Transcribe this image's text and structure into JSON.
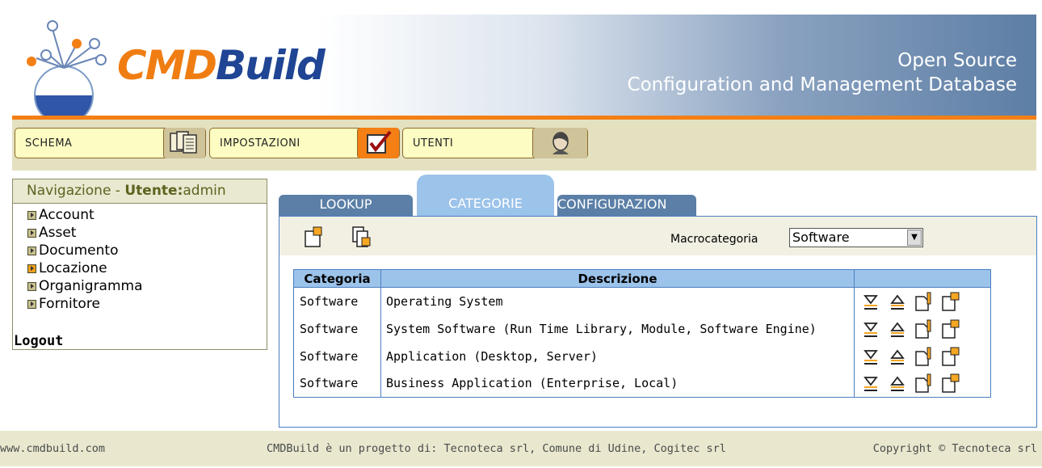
{
  "header": {
    "brand_part1": "CMD",
    "brand_part2": "Build",
    "tagline_line1": "Open Source",
    "tagline_line2": "Configuration and Management Database"
  },
  "menu": {
    "schema_label": "SCHEMA",
    "impostazioni_label": "IMPOSTAZIONI",
    "utenti_label": "UTENTI"
  },
  "nav": {
    "title_prefix": "Navigazione - ",
    "user_label": "Utente:",
    "user_name": "admin",
    "items": [
      {
        "label": "Account",
        "highlight": false
      },
      {
        "label": "Asset",
        "highlight": false
      },
      {
        "label": "Documento",
        "highlight": false
      },
      {
        "label": "Locazione",
        "highlight": true
      },
      {
        "label": "Organigramma",
        "highlight": false
      },
      {
        "label": "Fornitore",
        "highlight": false
      }
    ],
    "logout_label": "Logout"
  },
  "tabs": {
    "lookup": "LOOKUP",
    "categorie": "CATEGORIE",
    "configurazione": "CONFIGURAZION"
  },
  "toolbar": {
    "macro_label": "Macrocategoria",
    "macro_value": "Software"
  },
  "table": {
    "headers": [
      "Categoria",
      "Descrizione",
      ""
    ],
    "rows": [
      {
        "categoria": "Software",
        "descrizione": "Operating System"
      },
      {
        "categoria": "Software",
        "descrizione": "System Software (Run Time Library, Module, Software Engine)"
      },
      {
        "categoria": "Software",
        "descrizione": "Application (Desktop, Server)"
      },
      {
        "categoria": "Software",
        "descrizione": "Business Application (Enterprise, Local)"
      }
    ]
  },
  "footer": {
    "left": "www.cmdbuild.com",
    "middle": "CMDBuild è un progetto di: Tecnoteca srl, Comune di Udine, Cogitec srl",
    "right": "Copyright © Tecnoteca srl"
  },
  "colors": {
    "brand_orange": "#f37f15",
    "brand_blue": "#1f4594",
    "tab_blue": "#5b7fa6",
    "tab_active": "#9cc3ea",
    "panel_border": "#4a7fc1"
  }
}
